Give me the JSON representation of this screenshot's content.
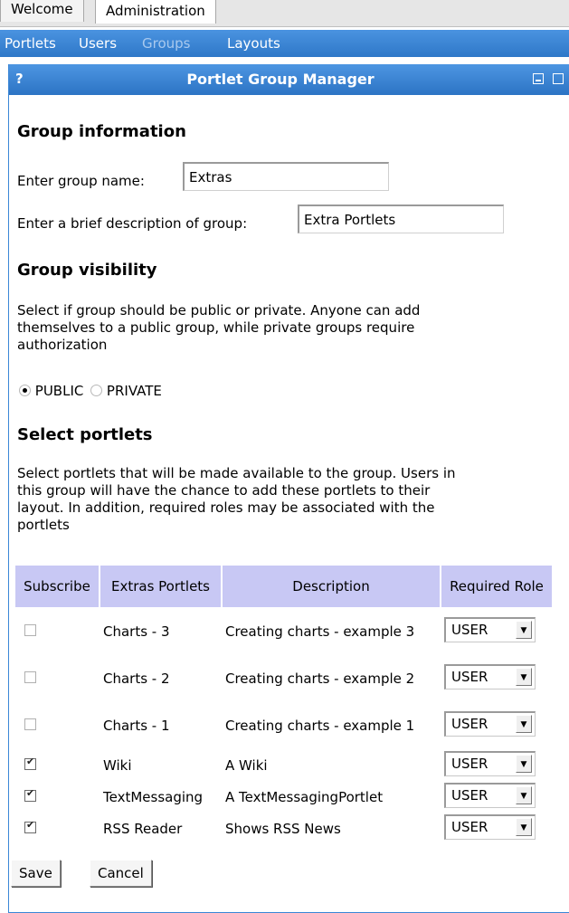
{
  "tabs": [
    {
      "label": "Welcome"
    },
    {
      "label": "Administration"
    }
  ],
  "subnav": [
    {
      "label": "Portlets"
    },
    {
      "label": "Users"
    },
    {
      "label": "Groups"
    },
    {
      "label": "Layouts"
    }
  ],
  "portlet": {
    "help": "?",
    "title": "Portlet Group Manager"
  },
  "group_info": {
    "heading": "Group information",
    "name_label": "Enter group name:",
    "name_value": "Extras",
    "desc_label": "Enter a brief description of group:",
    "desc_value": "Extra Portlets"
  },
  "visibility": {
    "heading": "Group visibility",
    "text_line1": "Select if group should be public or private. Anyone can add",
    "text_line2": "themselves to a public group, while private groups require",
    "text_line3": "authorization",
    "public_label": "PUBLIC",
    "private_label": "PRIVATE",
    "selected": "PUBLIC"
  },
  "select_portlets": {
    "heading": "Select portlets",
    "text_line1": "Select portlets that will be made available to the group. Users in",
    "text_line2": "this group will have the chance to add these portlets to their",
    "text_line3": "layout. In addition, required roles may be associated with the",
    "text_line4": "portlets"
  },
  "table": {
    "headers": [
      "Subscribe",
      "Extras Portlets",
      "Description",
      "Required Role"
    ],
    "rows": [
      {
        "subscribed": false,
        "name": "Charts - 3",
        "description": "Creating charts - example 3",
        "role": "USER"
      },
      {
        "subscribed": false,
        "name": "Charts - 2",
        "description": "Creating charts - example 2",
        "role": "USER"
      },
      {
        "subscribed": false,
        "name": "Charts - 1",
        "description": "Creating charts - example 1",
        "role": "USER"
      },
      {
        "subscribed": true,
        "name": "Wiki",
        "description": "A Wiki",
        "role": "USER"
      },
      {
        "subscribed": true,
        "name": "TextMessaging",
        "description": "A TextMessagingPortlet",
        "role": "USER"
      },
      {
        "subscribed": true,
        "name": "RSS Reader",
        "description": "Shows RSS News",
        "role": "USER"
      }
    ]
  },
  "buttons": {
    "save": "Save",
    "cancel": "Cancel"
  },
  "colors": {
    "nav_blue": "#3a86d6",
    "header_lavender": "#c8c8f4"
  }
}
